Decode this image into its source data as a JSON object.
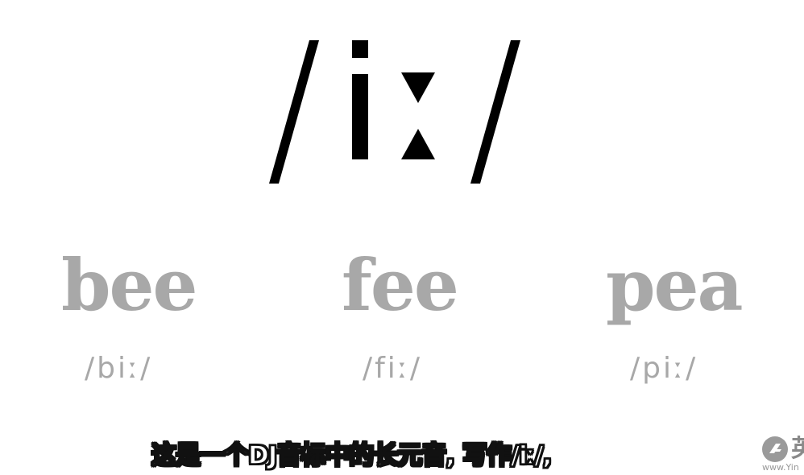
{
  "symbol": {
    "text": "/iː/",
    "color": "#000000"
  },
  "words": [
    {
      "word": "bee",
      "ipa": "/biː/"
    },
    {
      "word": "fee",
      "ipa": "/fiː/"
    },
    {
      "word": "pea",
      "ipa": "/piː/"
    }
  ],
  "subtitle": {
    "text": "这是一个DJ音标中的长元音, 写作/iː/,"
  },
  "watermark": {
    "logo_icon": "brand-logo-icon",
    "char": "英",
    "url": "www.Yin"
  },
  "colors": {
    "background": "#ffffff",
    "word_gray": "#a8a8a8",
    "subtitle_fill": "#ffffff",
    "subtitle_outline": "#111111"
  }
}
